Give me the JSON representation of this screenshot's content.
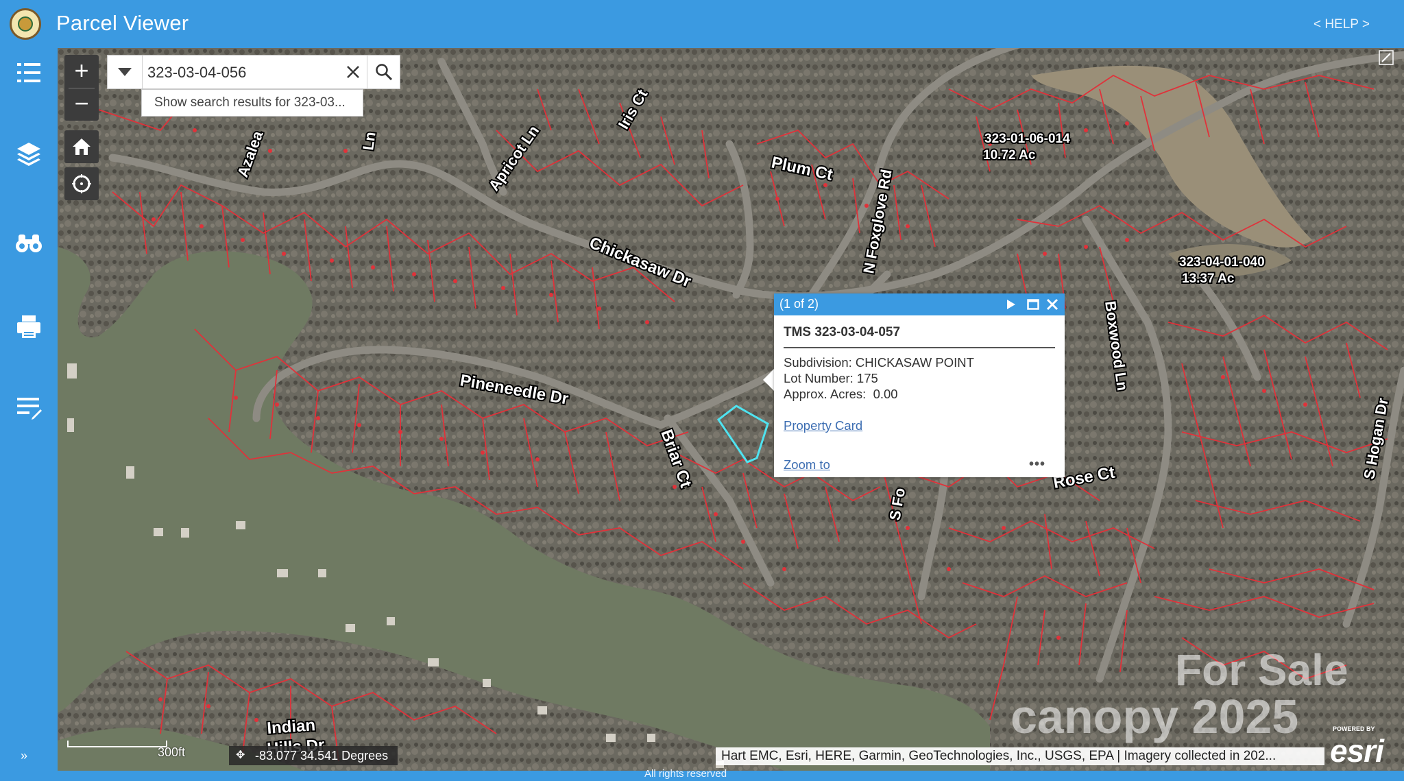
{
  "header": {
    "title": "Parcel Viewer",
    "help": "< HELP >",
    "logo_icon": "county-seal-icon"
  },
  "sidebar": {
    "items": [
      {
        "icon": "legend-list-icon"
      },
      {
        "icon": "layers-icon"
      },
      {
        "icon": "binoculars-icon"
      },
      {
        "icon": "print-icon"
      },
      {
        "icon": "edit-list-icon"
      }
    ],
    "expand_icon": "»"
  },
  "map": {
    "zoom_in": "+",
    "zoom_out": "−",
    "search": {
      "value": "323-03-04-056",
      "suggestion": "Show search results for 323-03..."
    },
    "labels": {
      "iris_ct": "Iris Ct",
      "apricot_ln": "Apricot Ln",
      "azalea": "Azalea",
      "plum_ct": "Plum Ct",
      "foxglove": "N Foxglove Rd",
      "chickasaw": "Chickasaw Dr",
      "pineneedle": "Pineneedle Dr",
      "briar": "Briar Ct",
      "boxwood": "Boxwood Ln",
      "rose": "Rose Ct",
      "s_fo": "S Fo",
      "hogan": "S Hogan Dr",
      "indian_hills_1": "Indian",
      "indian_hills_2": "Hills Dr",
      "ln_fragment": "Ln",
      "parcel1_id": "323-01-06-014",
      "parcel1_acres": "10.72 Ac",
      "parcel2_id": "323-04-01-040",
      "parcel2_acres": "13.37 Ac"
    },
    "popup": {
      "count": "(1 of 2)",
      "title": "TMS 323-03-04-057",
      "subdivision": "Subdivision: CHICKASAW POINT",
      "lot_number": "Lot Number: 175",
      "acres": "Approx. Acres:  0.00",
      "property_card": "Property Card",
      "zoom_to": "Zoom to",
      "more": "•••"
    },
    "scale": "300ft",
    "coordinates": "-83.077 34.541 Degrees",
    "attribution": "Hart EMC, Esri, HERE, Garmin, GeoTechnologies, Inc., USGS, EPA | Imagery collected in 202...",
    "esri_powered": "POWERED BY",
    "esri_logo": "esri",
    "watermark_1": "For Sale",
    "watermark_2": "canopy 2025"
  },
  "footer": {
    "text": "All rights reserved"
  },
  "colors": {
    "brand_blue": "#3b9ae1",
    "parcel_red": "#e0323a",
    "selection_cyan": "#4fe3f0",
    "water": "#6f7a62"
  }
}
